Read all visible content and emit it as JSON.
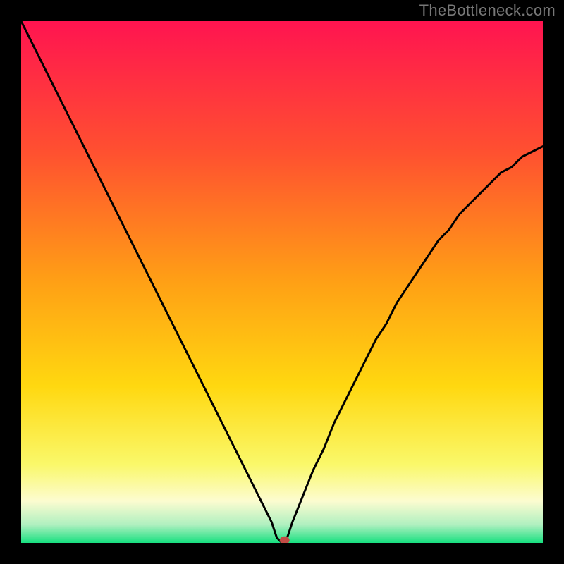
{
  "watermark": "TheBottleneck.com",
  "chart_data": {
    "type": "line",
    "title": "",
    "xlabel": "",
    "ylabel": "",
    "x": [
      0.0,
      0.02,
      0.04,
      0.06,
      0.08,
      0.1,
      0.12,
      0.14,
      0.16,
      0.18,
      0.2,
      0.22,
      0.24,
      0.26,
      0.28,
      0.3,
      0.32,
      0.34,
      0.36,
      0.38,
      0.4,
      0.42,
      0.44,
      0.46,
      0.48,
      0.49,
      0.5,
      0.51,
      0.52,
      0.54,
      0.56,
      0.58,
      0.6,
      0.62,
      0.64,
      0.66,
      0.68,
      0.7,
      0.72,
      0.74,
      0.76,
      0.78,
      0.8,
      0.82,
      0.84,
      0.86,
      0.88,
      0.9,
      0.92,
      0.94,
      0.96,
      0.98,
      1.0
    ],
    "values": [
      1.0,
      0.96,
      0.92,
      0.88,
      0.84,
      0.8,
      0.76,
      0.72,
      0.68,
      0.64,
      0.6,
      0.56,
      0.52,
      0.48,
      0.44,
      0.4,
      0.36,
      0.32,
      0.28,
      0.24,
      0.2,
      0.16,
      0.12,
      0.08,
      0.04,
      0.01,
      0.0,
      0.01,
      0.04,
      0.09,
      0.14,
      0.18,
      0.23,
      0.27,
      0.31,
      0.35,
      0.39,
      0.42,
      0.46,
      0.49,
      0.52,
      0.55,
      0.58,
      0.6,
      0.63,
      0.65,
      0.67,
      0.69,
      0.71,
      0.72,
      0.74,
      0.75,
      0.76
    ],
    "xlim": [
      0,
      1
    ],
    "ylim": [
      0,
      1
    ],
    "marker": {
      "x": 0.505,
      "y": 0.005
    },
    "background_gradient": {
      "stops": [
        {
          "pos": 0.0,
          "color": "#ff1450"
        },
        {
          "pos": 0.25,
          "color": "#ff5030"
        },
        {
          "pos": 0.5,
          "color": "#ffa015"
        },
        {
          "pos": 0.7,
          "color": "#ffd810"
        },
        {
          "pos": 0.85,
          "color": "#faf86a"
        },
        {
          "pos": 0.92,
          "color": "#fcfcd0"
        },
        {
          "pos": 0.965,
          "color": "#b0f0c0"
        },
        {
          "pos": 1.0,
          "color": "#18e080"
        }
      ]
    }
  }
}
